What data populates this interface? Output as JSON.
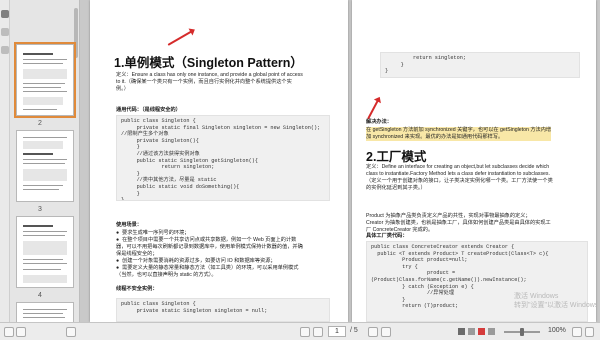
{
  "thumbnails": {
    "pages": [
      "2",
      "3",
      "4"
    ]
  },
  "left_page": {
    "title": "1.单例模式（Singleton Pattern）",
    "definition": "定义：Ensure a class has only one instance, and provide a global point of access\nto it.（确保某一个类只有一个实例，而且自行实例化并向整个系统提供这个实\n例。）",
    "generic_code_label": "通用代码：（是线程安全的）",
    "generic_code": "public class Singleton {\n     private static final Singleton singleton = new Singleton();\n//限制产生多个对象\n     private Singleton(){\n     }\n     //通过该方法获得实例对象\n     public static Singleton getSingleton(){\n             return singleton;\n     }\n     //类中其他方法，尽量是 static\n     public static void doSomething(){\n     }\n}",
    "usage_label": "使用场景：",
    "usage_items": "●  要求生成唯一序列号的环境；\n●  在整个项目中需要一个共享访问点或共享数据，例如一个 Web 页面上的计数\n器，可以不用把每次刷新都记录到数据库中，使用单例模式保持计数器的值，并确\n保是线程安全的；\n●  创建一个对象需要消耗的资源过多，如要访问 IO 和数据库等资源；\n●  需要定义大量的静态常量和静态方法（如工具类）的环境，可以采用单例模式\n（当然，也可以直接声明为 static 的方式）。",
    "unsafe_label": "线程不安全实例：",
    "unsafe_code": "public class Singleton {\n     private static Singleton singleton = null;"
  },
  "right_page": {
    "code_top": "         return singleton;\n     }\n}",
    "solution_label": "解决办法：",
    "solution_text": "在 getSingleton 方法前加 synchronized 关键字，也可以在 getSingleton 方法内增\n加 synchronized 来实现。最优的办法是如通用代码那样写。",
    "title": "2.工厂模式",
    "definition": "定义：Define an interface for creating an object,but let subclasses decide which\nclass to instantiate.Factory Method lets a class defer instantiation to subclasses.\n（定义一个用于创建对象的接口，让子类决定实例化哪一个类。工厂方法使一个类\n的实例化延迟到其子类。）",
    "product_text": "Product 为抽象产品类负责定义产品的共性，实现对事物最抽象的定义；\nCreator 为抽象创建类，也就是抽象工厂，具体如何创建产品类是由具体的实现工\n厂 ConcreteCreator 完成的。",
    "concrete_label": "具体工厂类代码：",
    "concrete_code": "public class ConcreteCreator extends Creator {\n  public <T extends Product> T createProduct(Class<T> c){\n          Product product=null;\n          try {\n                  product =\n(Product)Class.forName(c.getName()).newInstance();\n          } catch (Exception e) {\n                  //异常处理\n          }\n          return (T)product;",
    "watermark_line1": "激活 Windows",
    "watermark_line2": "转到\"设置\"以激活 Windows。"
  },
  "statusbar": {
    "page_input": "1",
    "page_total": "/ 5",
    "zoom": "100%"
  },
  "colors": {
    "accent_selection": "#e08a3a",
    "annotation_red": "#d52b2b"
  }
}
